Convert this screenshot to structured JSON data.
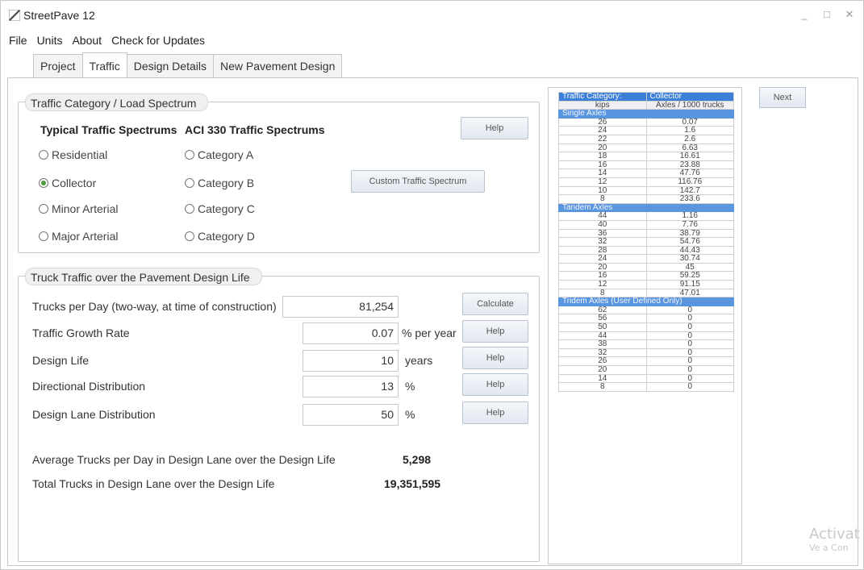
{
  "window": {
    "title": "StreetPave 12",
    "controls": [
      "_",
      "□",
      "✕"
    ]
  },
  "menu": [
    "File",
    "Units",
    "About",
    "Check for Updates"
  ],
  "tabs": [
    "Project",
    "Traffic",
    "Design Details",
    "New Pavement Design"
  ],
  "traffic_category": {
    "title": "Traffic Category / Load Spectrum",
    "typical_header": "Typical Traffic Spectrums",
    "aci_header": "ACI 330 Traffic Spectrums",
    "typical": [
      {
        "label": "Residential",
        "selected": false
      },
      {
        "label": "Collector",
        "selected": true
      },
      {
        "label": "Minor Arterial",
        "selected": false
      },
      {
        "label": "Major Arterial",
        "selected": false
      }
    ],
    "aci": [
      {
        "label": "Category A",
        "selected": false
      },
      {
        "label": "Category B",
        "selected": false
      },
      {
        "label": "Category C",
        "selected": false
      },
      {
        "label": "Category D",
        "selected": false
      }
    ],
    "help_label": "Help",
    "custom_label": "Custom Traffic Spectrum"
  },
  "truck_traffic": {
    "title": "Truck Traffic over the Pavement Design Life",
    "fields": [
      {
        "label": "Trucks per Day (two-way, at time of construction)",
        "value": "81,254",
        "unit": "",
        "button": "Calculate"
      },
      {
        "label": "Traffic Growth Rate",
        "value": "0.07",
        "unit": "% per year",
        "button": "Help"
      },
      {
        "label": "Design Life",
        "value": "10",
        "unit": "years",
        "button": "Help"
      },
      {
        "label": "Directional Distribution",
        "value": "13",
        "unit": "%",
        "button": "Help"
      },
      {
        "label": "Design Lane Distribution",
        "value": "50",
        "unit": "%",
        "button": "Help"
      }
    ],
    "avg_label": "Average Trucks per Day in Design Lane over the Design Life",
    "avg_value": "5,298",
    "total_label": "Total Trucks in Design Lane over the Design Life",
    "total_value": "19,351,595"
  },
  "spectrum_table": {
    "category_label": "Traffic Category:",
    "category_value": "Collector",
    "col1": "kips",
    "col2": "Axles / 1000 trucks",
    "sections": [
      {
        "name": "Single Axles",
        "rows": [
          [
            "26",
            "0.07"
          ],
          [
            "24",
            "1.6"
          ],
          [
            "22",
            "2.6"
          ],
          [
            "20",
            "6.63"
          ],
          [
            "18",
            "16.61"
          ],
          [
            "16",
            "23.88"
          ],
          [
            "14",
            "47.76"
          ],
          [
            "12",
            "116.76"
          ],
          [
            "10",
            "142.7"
          ],
          [
            "8",
            "233.6"
          ]
        ]
      },
      {
        "name": "Tandem Axles",
        "rows": [
          [
            "44",
            "1.16"
          ],
          [
            "40",
            "7.76"
          ],
          [
            "36",
            "38.79"
          ],
          [
            "32",
            "54.76"
          ],
          [
            "28",
            "44.43"
          ],
          [
            "24",
            "30.74"
          ],
          [
            "20",
            "45"
          ],
          [
            "16",
            "59.25"
          ],
          [
            "12",
            "91.15"
          ],
          [
            "8",
            "47.01"
          ]
        ]
      },
      {
        "name": "Tridem Axles (User Defined Only)",
        "rows": [
          [
            "62",
            "0"
          ],
          [
            "56",
            "0"
          ],
          [
            "50",
            "0"
          ],
          [
            "44",
            "0"
          ],
          [
            "38",
            "0"
          ],
          [
            "32",
            "0"
          ],
          [
            "26",
            "0"
          ],
          [
            "20",
            "0"
          ],
          [
            "14",
            "0"
          ],
          [
            "8",
            "0"
          ]
        ]
      }
    ]
  },
  "next_label": "Next",
  "watermark": {
    "line1": "Activat",
    "line2": "Ve a Con"
  }
}
